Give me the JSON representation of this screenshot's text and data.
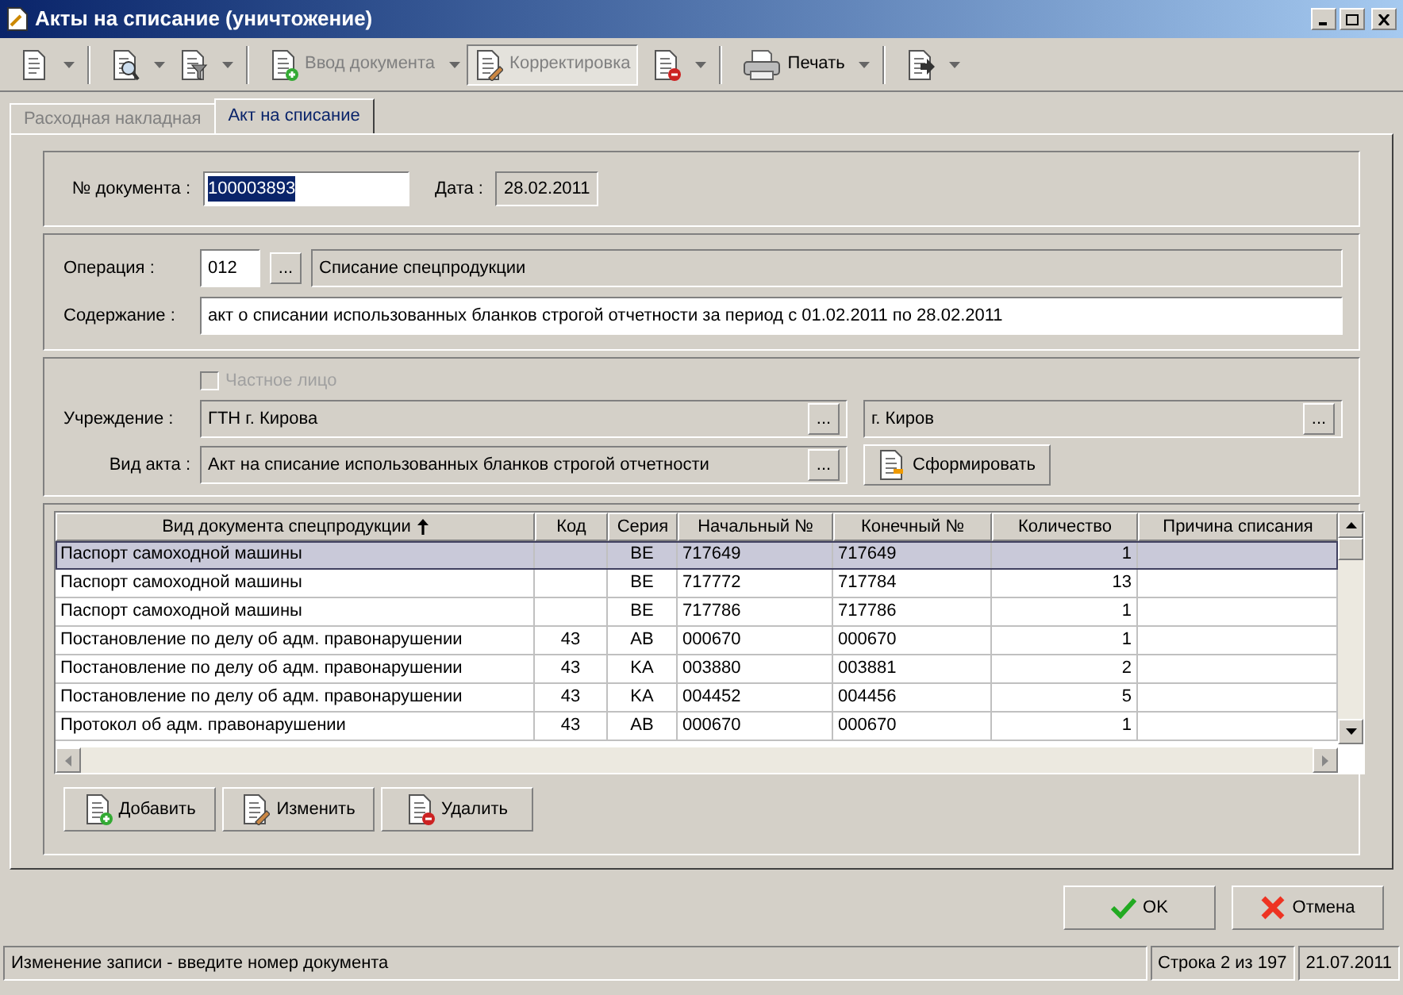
{
  "window": {
    "title": "Акты на списание (уничтожение)"
  },
  "toolbar": [
    {
      "kind": "icon",
      "dropdown": true,
      "disabled": false,
      "pressed": false
    },
    {
      "kind": "separator"
    },
    {
      "kind": "icon",
      "dropdown": true,
      "disabled": false,
      "pressed": false
    },
    {
      "kind": "icon",
      "dropdown": true,
      "disabled": false,
      "pressed": false
    },
    {
      "kind": "separator"
    },
    {
      "kind": "labeled",
      "label": "Ввод документа",
      "dropdown": true,
      "disabled": true,
      "pressed": false
    },
    {
      "kind": "labeled",
      "label": "Корректировка",
      "dropdown": false,
      "disabled": true,
      "pressed": true
    },
    {
      "kind": "icon",
      "dropdown": true,
      "disabled": false,
      "pressed": false
    },
    {
      "kind": "separator"
    },
    {
      "kind": "labeled",
      "label": "Печать",
      "dropdown": true,
      "disabled": false,
      "pressed": false
    },
    {
      "kind": "separator"
    },
    {
      "kind": "icon",
      "dropdown": true,
      "disabled": false,
      "pressed": false
    }
  ],
  "tabs": [
    {
      "label": "Расходная накладная",
      "selected": false
    },
    {
      "label": "Акт на списание",
      "selected": true
    }
  ],
  "document": {
    "number_label": "№ документа :",
    "number": "100003893",
    "number_text_selected": true,
    "date_label": "Дата :",
    "date": "28.02.2011"
  },
  "operation": {
    "label": "Операция :",
    "code": "012",
    "browse": "...",
    "name": "Списание спецпродукции",
    "content_label": "Содержание :",
    "content": "акт о списании использованных бланков строгой отчетности за период с 01.02.2011 по 28.02.2011"
  },
  "institution": {
    "private_person": {
      "label": "Частное лицо",
      "checked": false,
      "disabled": true
    },
    "label": "Учреждение :",
    "value": "ГТН г. Кирова",
    "browse": "...",
    "city": "г. Киров",
    "city_browse": "...",
    "act_type_label": "Вид акта :",
    "act_type": "Акт на списание использованных бланков строгой отчетности",
    "act_browse": "...",
    "form_button": "Сформировать"
  },
  "table": {
    "columns": [
      {
        "label": "Вид документа спецпродукции",
        "sorted": true
      },
      {
        "label": "Код",
        "sorted": false
      },
      {
        "label": "Серия",
        "sorted": false
      },
      {
        "label": "Начальный №",
        "sorted": false
      },
      {
        "label": "Конечный №",
        "sorted": false
      },
      {
        "label": "Количество",
        "sorted": false
      },
      {
        "label": "Причина списания",
        "sorted": false
      }
    ],
    "rows": [
      {
        "selected": true,
        "cells": [
          "Паспорт самоходной машины",
          "",
          "BE",
          "717649",
          "717649",
          "1",
          ""
        ]
      },
      {
        "selected": false,
        "cells": [
          "Паспорт самоходной машины",
          "",
          "BE",
          "717772",
          "717784",
          "13",
          ""
        ]
      },
      {
        "selected": false,
        "cells": [
          "Паспорт самоходной машины",
          "",
          "BE",
          "717786",
          "717786",
          "1",
          ""
        ]
      },
      {
        "selected": false,
        "cells": [
          "Постановление по делу об адм. правонарушении",
          "43",
          "AB",
          "000670",
          "000670",
          "1",
          ""
        ]
      },
      {
        "selected": false,
        "cells": [
          "Постановление по делу об адм. правонарушении",
          "43",
          "KA",
          "003880",
          "003881",
          "2",
          ""
        ]
      },
      {
        "selected": false,
        "cells": [
          "Постановление по делу об адм. правонарушении",
          "43",
          "KA",
          "004452",
          "004456",
          "5",
          ""
        ]
      },
      {
        "selected": false,
        "cells": [
          "Протокол об адм. правонарушении",
          "43",
          "AB",
          "000670",
          "000670",
          "1",
          ""
        ]
      }
    ]
  },
  "table_buttons": [
    "Добавить",
    "Изменить",
    "Удалить"
  ],
  "dialog_buttons": [
    "OK",
    "Отмена"
  ],
  "status_bar": [
    "Изменение записи - введите номер документа",
    "Строка 2 из 197",
    "21.07.2011"
  ]
}
